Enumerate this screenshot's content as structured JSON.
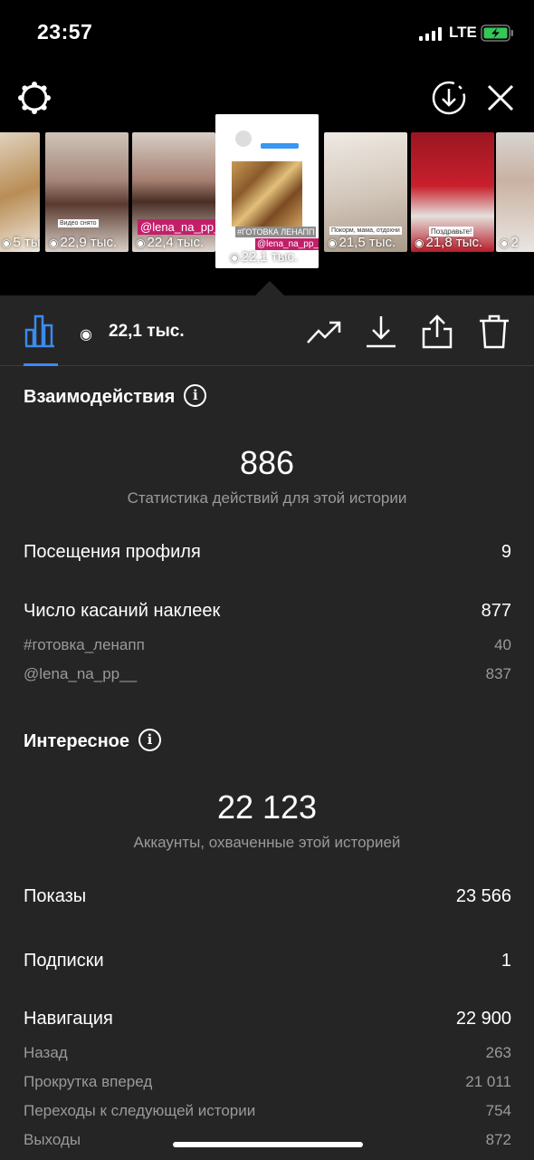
{
  "status_bar": {
    "time": "23:57",
    "network": "LTE"
  },
  "icons": {
    "settings": "gear-icon",
    "download_circle": "download-circle-icon",
    "close": "close-icon",
    "stats": "bar-chart-icon",
    "views": "eye-icon",
    "trend": "trend-icon",
    "download": "download-icon",
    "share": "share-icon",
    "delete": "trash-icon"
  },
  "thumbnails": [
    {
      "views": "5 тыс."
    },
    {
      "views": "22,9 тыс."
    },
    {
      "views": "22,4 тыс."
    },
    {
      "views": "22,1 тыс.",
      "active": true,
      "tag1": "#ГОТОВКА ЛЕНАПП",
      "tag2": "@lena_na_pp__"
    },
    {
      "views": "21,5 тыс."
    },
    {
      "views": "21,8 тыс."
    },
    {
      "views": "2"
    }
  ],
  "thumb_captions": {
    "t2": "Видео снято",
    "t3": "@lena_na_pp__",
    "t5": "Покорм, мама, отдохни",
    "t6": "Поздравьте!"
  },
  "toolbar": {
    "views": "22,1 тыс."
  },
  "interactions": {
    "title": "Взаимодействия",
    "total": "886",
    "subtitle": "Статистика действий для этой истории",
    "profile_visits_label": "Посещения профиля",
    "profile_visits_value": "9",
    "sticker_taps_label": "Число касаний наклеек",
    "sticker_taps_value": "877",
    "sticker_1_label": "#готовка_ленапп",
    "sticker_1_value": "40",
    "sticker_2_label": "@lena_na_pp__",
    "sticker_2_value": "837"
  },
  "discovery": {
    "title": "Интересное",
    "total": "22 123",
    "subtitle": "Аккаунты, охваченные этой историей",
    "impressions_label": "Показы",
    "impressions_value": "23 566",
    "follows_label": "Подписки",
    "follows_value": "1",
    "navigation_label": "Навигация",
    "navigation_value": "22 900",
    "back_label": "Назад",
    "back_value": "263",
    "forward_label": "Прокрутка вперед",
    "forward_value": "21 011",
    "next_story_label": "Переходы к следующей истории",
    "next_story_value": "754",
    "exits_label": "Выходы",
    "exits_value": "872"
  },
  "colors": {
    "accent": "#3b8af0",
    "panel": "#252525",
    "muted": "#9a9a9a"
  }
}
